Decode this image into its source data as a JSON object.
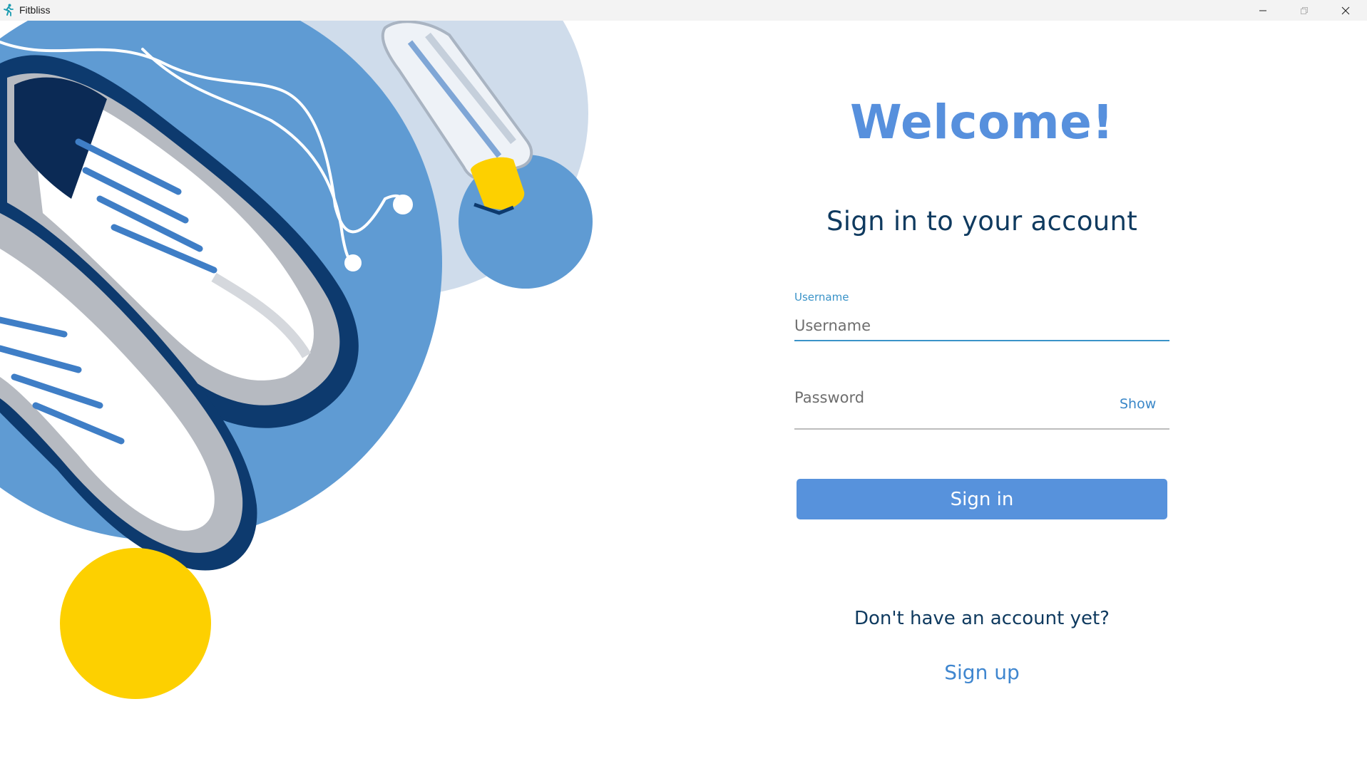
{
  "window": {
    "title": "Fitbliss",
    "app_icon": "running-person-icon",
    "controls": [
      "minimize-icon",
      "maximize-icon",
      "close-icon"
    ]
  },
  "art": {
    "description_icons": [
      "sneakers-illustration",
      "water-bottle-illustration",
      "earphones-illustration"
    ],
    "colors": {
      "big_circle": "#5f9bd3",
      "light_circle": "#cfdceb",
      "small_blue_circle": "#5f9bd3",
      "yellow_circle": "#fdd000",
      "shoe_dark": "#0d3a6e"
    }
  },
  "form": {
    "welcome": "Welcome!",
    "subtitle": "Sign in to your account",
    "username": {
      "label": "Username",
      "placeholder": "Username",
      "value": ""
    },
    "password": {
      "placeholder": "Password",
      "value": "",
      "show_label": "Show"
    },
    "signin_label": "Sign in",
    "no_account_text": "Don't have an account yet?",
    "signup_label": "Sign up"
  },
  "colors": {
    "accent": "#5792dc",
    "heading_dark": "#0f3a5f",
    "focus": "#3a93c8"
  }
}
